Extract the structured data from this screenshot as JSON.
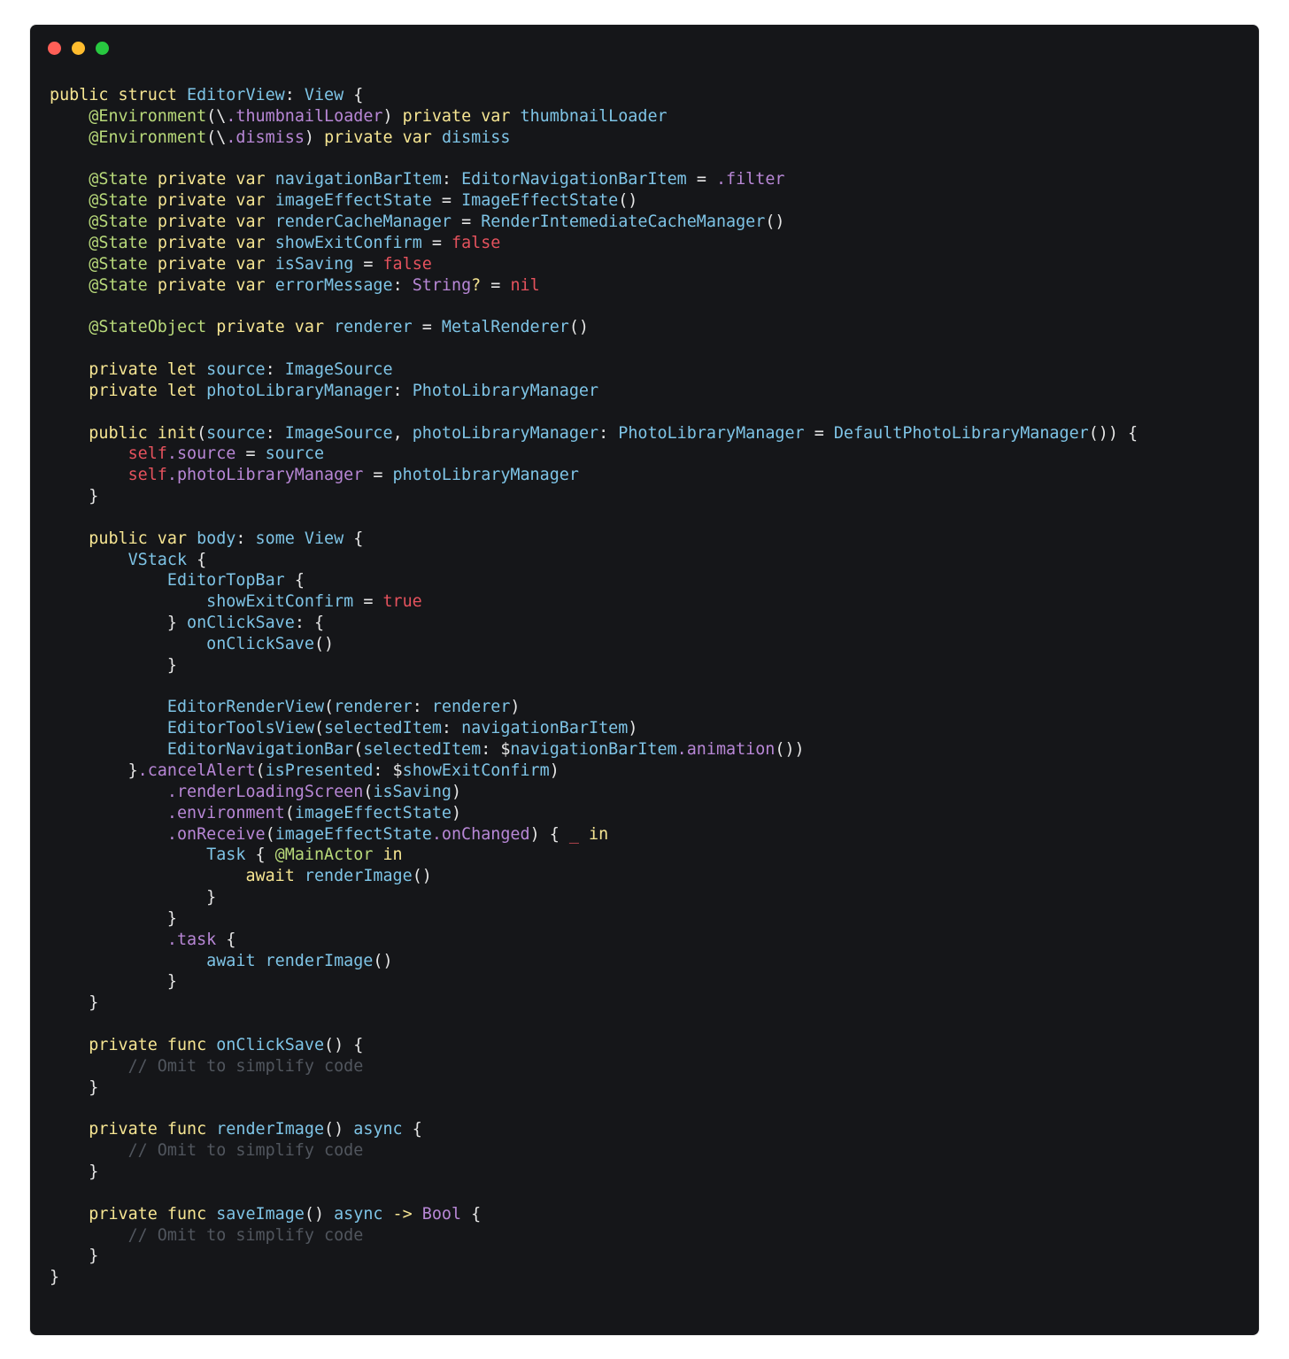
{
  "window": {
    "controls": [
      {
        "name": "close",
        "color": "#ff5f57"
      },
      {
        "name": "minimize",
        "color": "#febc2e"
      },
      {
        "name": "zoom",
        "color": "#28c840"
      }
    ]
  },
  "colors": {
    "kw": "#f6e592",
    "type": "#7ec4e6",
    "prop": "#b887d6",
    "attr": "#b8d97a",
    "lit": "#e5525d",
    "comment": "#51565e",
    "plain": "#e6e6e6"
  },
  "code_lines": [
    [
      [
        "kw",
        "public struct "
      ],
      [
        "type",
        "EditorView"
      ],
      [
        "plain",
        ": "
      ],
      [
        "type",
        "View"
      ],
      [
        "plain",
        " {"
      ]
    ],
    [
      [
        "plain",
        "    "
      ],
      [
        "attr",
        "@Environment"
      ],
      [
        "plain",
        "(\\"
      ],
      [
        "prop",
        ".thumbnailLoader"
      ],
      [
        "plain",
        ") "
      ],
      [
        "kw",
        "private var "
      ],
      [
        "type",
        "thumbnailLoader"
      ]
    ],
    [
      [
        "plain",
        "    "
      ],
      [
        "attr",
        "@Environment"
      ],
      [
        "plain",
        "(\\"
      ],
      [
        "prop",
        ".dismiss"
      ],
      [
        "plain",
        ") "
      ],
      [
        "kw",
        "private var "
      ],
      [
        "type",
        "dismiss"
      ]
    ],
    [],
    [
      [
        "plain",
        "    "
      ],
      [
        "attr",
        "@State "
      ],
      [
        "kw",
        "private var "
      ],
      [
        "type",
        "navigationBarItem"
      ],
      [
        "plain",
        ": "
      ],
      [
        "type",
        "EditorNavigationBarItem"
      ],
      [
        "plain",
        " = "
      ],
      [
        "prop",
        ".filter"
      ]
    ],
    [
      [
        "plain",
        "    "
      ],
      [
        "attr",
        "@State "
      ],
      [
        "kw",
        "private var "
      ],
      [
        "type",
        "imageEffectState"
      ],
      [
        "plain",
        " = "
      ],
      [
        "type",
        "ImageEffectState"
      ],
      [
        "plain",
        "()"
      ]
    ],
    [
      [
        "plain",
        "    "
      ],
      [
        "attr",
        "@State "
      ],
      [
        "kw",
        "private var "
      ],
      [
        "type",
        "renderCacheManager"
      ],
      [
        "plain",
        " = "
      ],
      [
        "type",
        "RenderIntemediateCacheManager"
      ],
      [
        "plain",
        "()"
      ]
    ],
    [
      [
        "plain",
        "    "
      ],
      [
        "attr",
        "@State "
      ],
      [
        "kw",
        "private var "
      ],
      [
        "type",
        "showExitConfirm"
      ],
      [
        "plain",
        " = "
      ],
      [
        "lit",
        "false"
      ]
    ],
    [
      [
        "plain",
        "    "
      ],
      [
        "attr",
        "@State "
      ],
      [
        "kw",
        "private var "
      ],
      [
        "type",
        "isSaving"
      ],
      [
        "plain",
        " = "
      ],
      [
        "lit",
        "false"
      ]
    ],
    [
      [
        "plain",
        "    "
      ],
      [
        "attr",
        "@State "
      ],
      [
        "kw",
        "private var "
      ],
      [
        "type",
        "errorMessage"
      ],
      [
        "plain",
        ": "
      ],
      [
        "prop",
        "String"
      ],
      [
        "kw",
        "?"
      ],
      [
        "plain",
        " = "
      ],
      [
        "lit",
        "nil"
      ]
    ],
    [],
    [
      [
        "plain",
        "    "
      ],
      [
        "attr",
        "@StateObject "
      ],
      [
        "kw",
        "private var "
      ],
      [
        "type",
        "renderer"
      ],
      [
        "plain",
        " = "
      ],
      [
        "type",
        "MetalRenderer"
      ],
      [
        "plain",
        "()"
      ]
    ],
    [],
    [
      [
        "plain",
        "    "
      ],
      [
        "kw",
        "private let "
      ],
      [
        "type",
        "source"
      ],
      [
        "plain",
        ": "
      ],
      [
        "type",
        "ImageSource"
      ]
    ],
    [
      [
        "plain",
        "    "
      ],
      [
        "kw",
        "private let "
      ],
      [
        "type",
        "photoLibraryManager"
      ],
      [
        "plain",
        ": "
      ],
      [
        "type",
        "PhotoLibraryManager"
      ]
    ],
    [],
    [
      [
        "plain",
        "    "
      ],
      [
        "kw",
        "public init"
      ],
      [
        "plain",
        "("
      ],
      [
        "type",
        "source"
      ],
      [
        "plain",
        ": "
      ],
      [
        "type",
        "ImageSource"
      ],
      [
        "plain",
        ", "
      ],
      [
        "type",
        "photoLibraryManager"
      ],
      [
        "plain",
        ": "
      ],
      [
        "type",
        "PhotoLibraryManager"
      ],
      [
        "plain",
        " = "
      ],
      [
        "type",
        "DefaultPhotoLibraryManager"
      ],
      [
        "plain",
        "()) {"
      ]
    ],
    [
      [
        "plain",
        "        "
      ],
      [
        "lit",
        "self"
      ],
      [
        "prop",
        ".source"
      ],
      [
        "plain",
        " = "
      ],
      [
        "type",
        "source"
      ]
    ],
    [
      [
        "plain",
        "        "
      ],
      [
        "lit",
        "self"
      ],
      [
        "prop",
        ".photoLibraryManager"
      ],
      [
        "plain",
        " = "
      ],
      [
        "type",
        "photoLibraryManager"
      ]
    ],
    [
      [
        "plain",
        "    }"
      ]
    ],
    [],
    [
      [
        "plain",
        "    "
      ],
      [
        "kw",
        "public var "
      ],
      [
        "type",
        "body"
      ],
      [
        "plain",
        ": "
      ],
      [
        "type",
        "some View"
      ],
      [
        "plain",
        " {"
      ]
    ],
    [
      [
        "plain",
        "        "
      ],
      [
        "type",
        "VStack"
      ],
      [
        "plain",
        " {"
      ]
    ],
    [
      [
        "plain",
        "            "
      ],
      [
        "type",
        "EditorTopBar"
      ],
      [
        "plain",
        " {"
      ]
    ],
    [
      [
        "plain",
        "                "
      ],
      [
        "type",
        "showExitConfirm"
      ],
      [
        "plain",
        " = "
      ],
      [
        "lit",
        "true"
      ]
    ],
    [
      [
        "plain",
        "            } "
      ],
      [
        "type",
        "onClickSave"
      ],
      [
        "plain",
        ": {"
      ]
    ],
    [
      [
        "plain",
        "                "
      ],
      [
        "type",
        "onClickSave"
      ],
      [
        "plain",
        "()"
      ]
    ],
    [
      [
        "plain",
        "            }"
      ]
    ],
    [],
    [
      [
        "plain",
        "            "
      ],
      [
        "type",
        "EditorRenderView"
      ],
      [
        "plain",
        "("
      ],
      [
        "type",
        "renderer"
      ],
      [
        "plain",
        ": "
      ],
      [
        "type",
        "renderer"
      ],
      [
        "plain",
        ")"
      ]
    ],
    [
      [
        "plain",
        "            "
      ],
      [
        "type",
        "EditorToolsView"
      ],
      [
        "plain",
        "("
      ],
      [
        "type",
        "selectedItem"
      ],
      [
        "plain",
        ": "
      ],
      [
        "type",
        "navigationBarItem"
      ],
      [
        "plain",
        ")"
      ]
    ],
    [
      [
        "plain",
        "            "
      ],
      [
        "type",
        "EditorNavigationBar"
      ],
      [
        "plain",
        "("
      ],
      [
        "type",
        "selectedItem"
      ],
      [
        "plain",
        ": $"
      ],
      [
        "type",
        "navigationBarItem"
      ],
      [
        "prop",
        ".animation"
      ],
      [
        "plain",
        "())"
      ]
    ],
    [
      [
        "plain",
        "        }"
      ],
      [
        "prop",
        ".cancelAlert"
      ],
      [
        "plain",
        "("
      ],
      [
        "type",
        "isPresented"
      ],
      [
        "plain",
        ": $"
      ],
      [
        "type",
        "showExitConfirm"
      ],
      [
        "plain",
        ")"
      ]
    ],
    [
      [
        "plain",
        "            "
      ],
      [
        "prop",
        ".renderLoadingScreen"
      ],
      [
        "plain",
        "("
      ],
      [
        "type",
        "isSaving"
      ],
      [
        "plain",
        ")"
      ]
    ],
    [
      [
        "plain",
        "            "
      ],
      [
        "prop",
        ".environment"
      ],
      [
        "plain",
        "("
      ],
      [
        "type",
        "imageEffectState"
      ],
      [
        "plain",
        ")"
      ]
    ],
    [
      [
        "plain",
        "            "
      ],
      [
        "prop",
        ".onReceive"
      ],
      [
        "plain",
        "("
      ],
      [
        "type",
        "imageEffectState"
      ],
      [
        "prop",
        ".onChanged"
      ],
      [
        "plain",
        ") { "
      ],
      [
        "lit",
        "_"
      ],
      [
        "kw",
        " in"
      ]
    ],
    [
      [
        "plain",
        "                "
      ],
      [
        "type",
        "Task"
      ],
      [
        "plain",
        " { "
      ],
      [
        "attr",
        "@MainActor"
      ],
      [
        "kw",
        " in"
      ]
    ],
    [
      [
        "plain",
        "                    "
      ],
      [
        "kw",
        "await "
      ],
      [
        "type",
        "renderImage"
      ],
      [
        "plain",
        "()"
      ]
    ],
    [
      [
        "plain",
        "                }"
      ]
    ],
    [
      [
        "plain",
        "            }"
      ]
    ],
    [
      [
        "plain",
        "            "
      ],
      [
        "prop",
        ".task"
      ],
      [
        "plain",
        " {"
      ]
    ],
    [
      [
        "plain",
        "                "
      ],
      [
        "type",
        "await renderImage"
      ],
      [
        "plain",
        "()"
      ]
    ],
    [
      [
        "plain",
        "            }"
      ]
    ],
    [
      [
        "plain",
        "    }"
      ]
    ],
    [],
    [
      [
        "plain",
        "    "
      ],
      [
        "kw",
        "private func "
      ],
      [
        "type",
        "onClickSave"
      ],
      [
        "plain",
        "() {"
      ]
    ],
    [
      [
        "plain",
        "        "
      ],
      [
        "comment",
        "// Omit to simplify code"
      ]
    ],
    [
      [
        "plain",
        "    }"
      ]
    ],
    [],
    [
      [
        "plain",
        "    "
      ],
      [
        "kw",
        "private func "
      ],
      [
        "type",
        "renderImage"
      ],
      [
        "plain",
        "() "
      ],
      [
        "type",
        "async"
      ],
      [
        "plain",
        " {"
      ]
    ],
    [
      [
        "plain",
        "        "
      ],
      [
        "comment",
        "// Omit to simplify code"
      ]
    ],
    [
      [
        "plain",
        "    }"
      ]
    ],
    [],
    [
      [
        "plain",
        "    "
      ],
      [
        "kw",
        "private func "
      ],
      [
        "type",
        "saveImage"
      ],
      [
        "plain",
        "() "
      ],
      [
        "type",
        "async "
      ],
      [
        "kw",
        "-> "
      ],
      [
        "prop",
        "Bool"
      ],
      [
        "plain",
        " {"
      ]
    ],
    [
      [
        "plain",
        "        "
      ],
      [
        "comment",
        "// Omit to simplify code"
      ]
    ],
    [
      [
        "plain",
        "    }"
      ]
    ],
    [
      [
        "plain",
        "}"
      ]
    ]
  ]
}
